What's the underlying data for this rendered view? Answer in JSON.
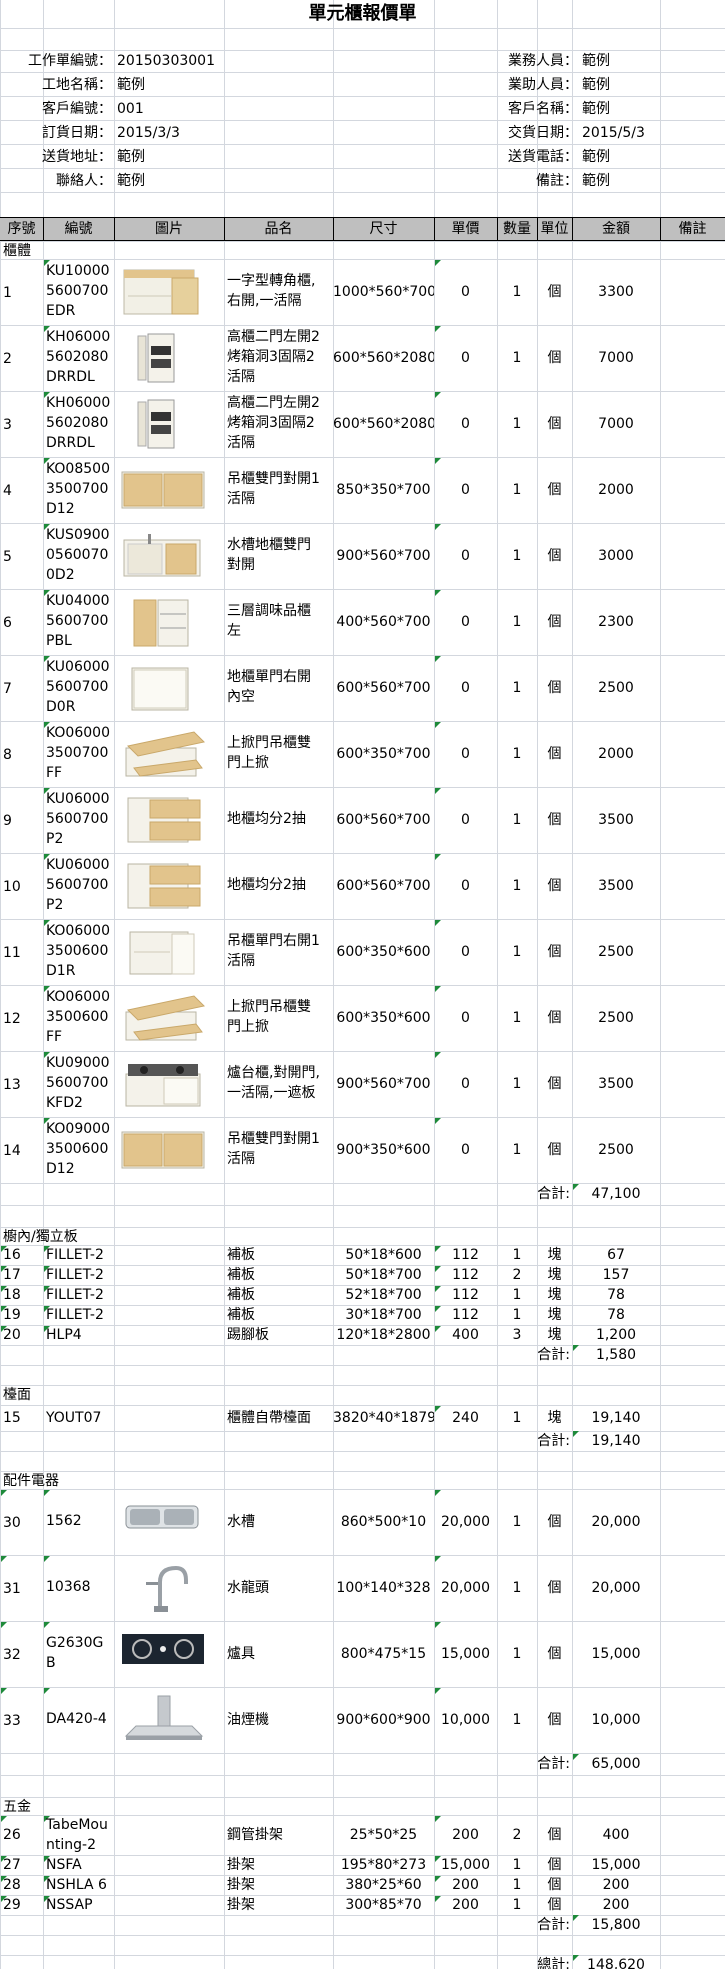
{
  "title": "單元櫃報價單",
  "info_left": [
    {
      "label": "工作單編號：",
      "value": "20150303001"
    },
    {
      "label": "工地名稱：",
      "value": "範例"
    },
    {
      "label": "客戶編號：",
      "value": "001"
    },
    {
      "label": "訂貨日期：",
      "value": "2015/3/3"
    },
    {
      "label": "送貨地址：",
      "value": "範例"
    },
    {
      "label": "聯絡人：",
      "value": "範例"
    }
  ],
  "info_right": [
    {
      "label": "業務人員：",
      "value": "範例"
    },
    {
      "label": "業助人員：",
      "value": "範例"
    },
    {
      "label": "客戶名稱：",
      "value": "範例"
    },
    {
      "label": "交貨日期：",
      "value": "2015/5/3"
    },
    {
      "label": "送貨電話：",
      "value": "範例"
    },
    {
      "label": "備註：",
      "value": "範例"
    }
  ],
  "columns": [
    "序號",
    "編號",
    "圖片",
    "品名",
    "尺寸",
    "單價",
    "數量",
    "單位",
    "金額",
    "備註"
  ],
  "sections": {
    "cabinet": {
      "name": "櫃體",
      "items": [
        {
          "no": "1",
          "code": [
            "KU10000",
            "5600700",
            "EDR"
          ],
          "img": "corner-cabinet-image",
          "name": [
            "一字型轉角櫃,",
            "右開,一活隔"
          ],
          "size": "1000*560*700",
          "price": "0",
          "qty": "1",
          "unit": "個",
          "amount": "3300"
        },
        {
          "no": "2",
          "code": [
            "KH06000",
            "5602080",
            "DRRDL"
          ],
          "img": "tall-cabinet-image",
          "name": [
            "高櫃二門左開2",
            "烤箱洞3固隔2",
            "活隔"
          ],
          "size": "600*560*2080",
          "price": "0",
          "qty": "1",
          "unit": "個",
          "amount": "7000"
        },
        {
          "no": "3",
          "code": [
            "KH06000",
            "5602080",
            "DRRDL"
          ],
          "img": "tall-cabinet-image",
          "name": [
            "高櫃二門左開2",
            "烤箱洞3固隔2",
            "活隔"
          ],
          "size": "600*560*2080",
          "price": "0",
          "qty": "1",
          "unit": "個",
          "amount": "7000"
        },
        {
          "no": "4",
          "code": [
            "KO08500",
            "3500700",
            "D12"
          ],
          "img": "wall-cabinet-double-door-image",
          "name": [
            "吊櫃雙門對開1",
            "活隔"
          ],
          "size": "850*350*700",
          "price": "0",
          "qty": "1",
          "unit": "個",
          "amount": "2000"
        },
        {
          "no": "5",
          "code": [
            "KUS0900",
            "0560070",
            "0D2"
          ],
          "img": "sink-cabinet-image",
          "name": [
            "水槽地櫃雙門",
            "對開"
          ],
          "size": "900*560*700",
          "price": "0",
          "qty": "1",
          "unit": "個",
          "amount": "3000"
        },
        {
          "no": "6",
          "code": [
            "KU04000",
            "5600700",
            "PBL"
          ],
          "img": "spice-pullout-image",
          "name": [
            "三層調味品櫃",
            "左"
          ],
          "size": "400*560*700",
          "price": "0",
          "qty": "1",
          "unit": "個",
          "amount": "2300"
        },
        {
          "no": "7",
          "code": [
            "KU06000",
            "5600700",
            "D0R"
          ],
          "img": "base-cabinet-single-door-image",
          "name": [
            "地櫃單門右開",
            "內空"
          ],
          "size": "600*560*700",
          "price": "0",
          "qty": "1",
          "unit": "個",
          "amount": "2500"
        },
        {
          "no": "8",
          "code": [
            "KO06000",
            "3500700",
            "FF"
          ],
          "img": "lift-up-wall-cabinet-image",
          "name": [
            "上掀門吊櫃雙",
            "門上掀"
          ],
          "size": "600*350*700",
          "price": "0",
          "qty": "1",
          "unit": "個",
          "amount": "2000"
        },
        {
          "no": "9",
          "code": [
            "KU06000",
            "5600700",
            "P2"
          ],
          "img": "drawer-base-cabinet-image",
          "name": [
            "地櫃均分2抽"
          ],
          "size": "600*560*700",
          "price": "0",
          "qty": "1",
          "unit": "個",
          "amount": "3500"
        },
        {
          "no": "10",
          "code": [
            "KU06000",
            "5600700",
            "P2"
          ],
          "img": "drawer-base-cabinet-image",
          "name": [
            "地櫃均分2抽"
          ],
          "size": "600*560*700",
          "price": "0",
          "qty": "1",
          "unit": "個",
          "amount": "3500"
        },
        {
          "no": "11",
          "code": [
            "KO06000",
            "3500600",
            "D1R"
          ],
          "img": "wall-cabinet-single-door-image",
          "name": [
            "吊櫃單門右開1",
            "活隔"
          ],
          "size": "600*350*600",
          "price": "0",
          "qty": "1",
          "unit": "個",
          "amount": "2500"
        },
        {
          "no": "12",
          "code": [
            "KO06000",
            "3500600",
            "FF"
          ],
          "img": "lift-up-wall-cabinet-image",
          "name": [
            "上掀門吊櫃雙",
            "門上掀"
          ],
          "size": "600*350*600",
          "price": "0",
          "qty": "1",
          "unit": "個",
          "amount": "2500"
        },
        {
          "no": "13",
          "code": [
            "KU09000",
            "5600700",
            "KFD2"
          ],
          "img": "stove-cabinet-image",
          "name": [
            "爐台櫃,對開門,",
            "一活隔,一遮板"
          ],
          "size": "900*560*700",
          "price": "0",
          "qty": "1",
          "unit": "個",
          "amount": "3500"
        },
        {
          "no": "14",
          "code": [
            "KO09000",
            "3500600",
            "D12"
          ],
          "img": "wall-cabinet-double-door-image",
          "name": [
            "吊櫃雙門對開1",
            "活隔"
          ],
          "size": "900*350*600",
          "price": "0",
          "qty": "1",
          "unit": "個",
          "amount": "2500"
        }
      ],
      "subtotal_label": "合計:",
      "subtotal": "47,100"
    },
    "fillers": {
      "name": "櫥內/獨立板",
      "items": [
        {
          "no": "16",
          "code": "FILLET-2",
          "name": "補板",
          "size": "50*18*600",
          "price": "112",
          "qty": "1",
          "unit": "塊",
          "amount": "67"
        },
        {
          "no": "17",
          "code": "FILLET-2",
          "name": "補板",
          "size": "50*18*700",
          "price": "112",
          "qty": "2",
          "unit": "塊",
          "amount": "157"
        },
        {
          "no": "18",
          "code": "FILLET-2",
          "name": "補板",
          "size": "52*18*700",
          "price": "112",
          "qty": "1",
          "unit": "塊",
          "amount": "78"
        },
        {
          "no": "19",
          "code": "FILLET-2",
          "name": "補板",
          "size": "30*18*700",
          "price": "112",
          "qty": "1",
          "unit": "塊",
          "amount": "78"
        },
        {
          "no": "20",
          "code": "HLP4",
          "name": "踢腳板",
          "size": "120*18*2800",
          "price": "400",
          "qty": "3",
          "unit": "塊",
          "amount": "1,200"
        }
      ],
      "subtotal_label": "合計:",
      "subtotal": "1,580"
    },
    "countertop": {
      "name": "檯面",
      "items": [
        {
          "no": "15",
          "code": "YOUT07",
          "name": "櫃體自帶檯面",
          "size": "3820*40*1879",
          "price": "240",
          "qty": "1",
          "unit": "塊",
          "amount": "19,140"
        }
      ],
      "subtotal_label": "合計:",
      "subtotal": "19,140"
    },
    "appliances": {
      "name": "配件電器",
      "items": [
        {
          "no": "30",
          "code": [
            "1562"
          ],
          "img": "sink-image",
          "name": [
            "水槽"
          ],
          "size": "860*500*10",
          "price": "20,000",
          "qty": "1",
          "unit": "個",
          "amount": "20,000"
        },
        {
          "no": "31",
          "code": [
            "10368"
          ],
          "img": "faucet-image",
          "name": [
            "水龍頭"
          ],
          "size": "100*140*328",
          "price": "20,000",
          "qty": "1",
          "unit": "個",
          "amount": "20,000"
        },
        {
          "no": "32",
          "code": [
            "G2630G",
            "B"
          ],
          "img": "gas-hob-image",
          "name": [
            "爐具"
          ],
          "size": "800*475*15",
          "price": "15,000",
          "qty": "1",
          "unit": "個",
          "amount": "15,000"
        },
        {
          "no": "33",
          "code": [
            "DA420-4"
          ],
          "img": "range-hood-image",
          "name": [
            "油煙機"
          ],
          "size": "900*600*900",
          "price": "10,000",
          "qty": "1",
          "unit": "個",
          "amount": "10,000"
        }
      ],
      "subtotal_label": "合計:",
      "subtotal": "65,000"
    },
    "hardware": {
      "name": "五金",
      "items": [
        {
          "no": "26",
          "code": [
            "TabeMou",
            "nting-2"
          ],
          "name": "鋼管掛架",
          "size": "25*50*25",
          "price": "200",
          "qty": "2",
          "unit": "個",
          "amount": "400"
        },
        {
          "no": "27",
          "code": [
            "NSFA"
          ],
          "name": "掛架",
          "size": "195*80*273",
          "price": "15,000",
          "qty": "1",
          "unit": "個",
          "amount": "15,000"
        },
        {
          "no": "28",
          "code": [
            "NSHLA 6"
          ],
          "name": "掛架",
          "size": "380*25*60",
          "price": "200",
          "qty": "1",
          "unit": "個",
          "amount": "200"
        },
        {
          "no": "29",
          "code": [
            "NSSAP"
          ],
          "name": "掛架",
          "size": "300*85*70",
          "price": "200",
          "qty": "1",
          "unit": "個",
          "amount": "200"
        }
      ],
      "subtotal_label": "合計:",
      "subtotal": "15,800"
    }
  },
  "total_label": "總計:",
  "total": "148,620",
  "colors": {
    "header_bg": "#bfbfbf",
    "grid": "#d3d7de",
    "wood": "#e2c48c",
    "panel": "#f1efe6",
    "marker": "#1e8a3a"
  }
}
